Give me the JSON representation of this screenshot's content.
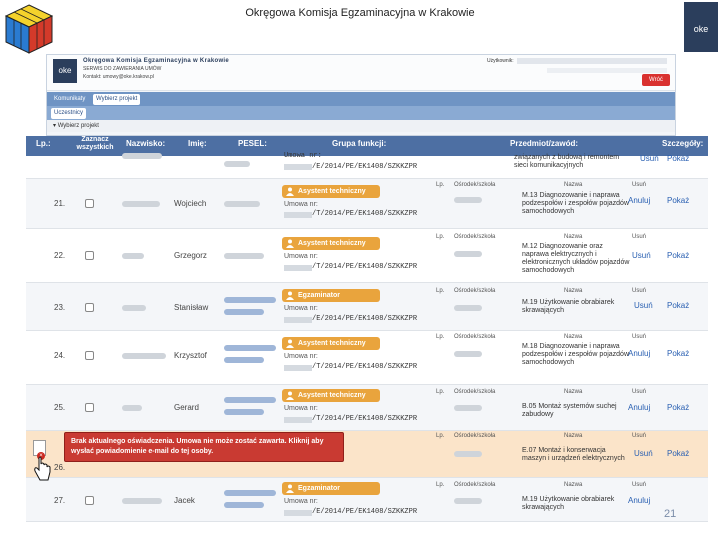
{
  "slide_title": "Okręgowa Komisja Egzaminacyjna w Krakowie",
  "page_number": "21",
  "app": {
    "name": "Okręgowa Komisja Egzaminacyjna w Krakowie",
    "subtitle": "SERWIS DO ZAWIERANIA UMÓW",
    "contact": "Kontakt: umowy@oke.krakow.pl",
    "user_label": "Użytkownik:",
    "back_button": "Wróć",
    "logo_text": "oke"
  },
  "nav": {
    "tabs": [
      {
        "label": "Komunikaty",
        "active": false
      },
      {
        "label": "Wybierz projekt",
        "active": true
      }
    ],
    "sub_tab": "Uczestnicy",
    "select_project": "Wybierz projekt"
  },
  "table": {
    "headers": {
      "lp": "Lp.:",
      "zaznacz": "Zaznacz wszystkich",
      "nazwisko": "Nazwisko:",
      "imie": "Imię:",
      "pesel": "PESEL:",
      "grupa": "Grupa funkcji:",
      "przedmiot": "Przedmiot/zawód:",
      "szczegoly": "Szczegóły:"
    },
    "sub_headers": {
      "lp": "Lp.",
      "osrodek": "Ośrodek/szkoła",
      "nazwa": "Nazwa",
      "usun": "Usuń"
    },
    "umowa_label": "Umowa nr:",
    "rows": [
      {
        "lp": "",
        "imie": "",
        "role": "",
        "umowa": "/E/2014/PE/EK1408/SZKKZPR",
        "przedmiot": "związanych z budową i remontem sieci komunikacyjnych",
        "action": "Usuń",
        "details": "Pokaż"
      },
      {
        "lp": "21.",
        "imie": "Wojciech",
        "role": "Asystent techniczny",
        "umowa": "/T/2014/PE/EK1408/SZKKZPR",
        "przedmiot": "M.13 Diagnozowanie i naprawa podzespołów i zespołów pojazdów samochodowych",
        "action": "Anuluj",
        "details": "Pokaż"
      },
      {
        "lp": "22.",
        "imie": "Grzegorz",
        "role": "Asystent techniczny",
        "umowa": "/T/2014/PE/EK1408/SZKKZPR",
        "przedmiot": "M.12 Diagnozowanie oraz naprawa elektrycznych i elektronicznych układów pojazdów samochodowych",
        "action": "Usuń",
        "details": "Pokaż"
      },
      {
        "lp": "23.",
        "imie": "Stanisław",
        "role": "Egzaminator",
        "umowa": "/E/2014/PE/EK1408/SZKKZPR",
        "przedmiot": "M.19 Użytkowanie obrabiarek skrawających",
        "action": "Usuń",
        "details": "Pokaż"
      },
      {
        "lp": "24.",
        "imie": "Krzysztof",
        "role": "Asystent techniczny",
        "umowa": "/T/2014/PE/EK1408/SZKKZPR",
        "przedmiot": "M.18 Diagnozowanie i naprawa podzespołów i zespołów pojazdów samochodowych",
        "action": "Anuluj",
        "details": "Pokaż"
      },
      {
        "lp": "25.",
        "imie": "Gerard",
        "role": "Asystent techniczny",
        "umowa": "/T/2014/PE/EK1408/SZKKZPR",
        "przedmiot": "B.05 Montaż systemów suchej zabudowy",
        "action": "Anuluj",
        "details": "Pokaż"
      },
      {
        "lp": "26.",
        "imie": "",
        "role": "",
        "umowa": "",
        "przedmiot": "E.07 Montaż i konserwacja maszyn i urządzeń elektrycznych",
        "action": "Usuń",
        "details": "Pokaż"
      },
      {
        "lp": "27.",
        "imie": "Jacek",
        "role": "Egzaminator",
        "umowa": "/E/2014/PE/EK1408/SZKKZPR",
        "przedmiot": "M.19 Użytkowanie obrabiarek skrawających",
        "action": "Anuluj",
        "details": "Pokaż"
      }
    ]
  },
  "error_message": "Brak aktualnego oświadczenia. Umowa nie może zostać zawarta. Kliknij aby wysłać powiadomienie e-mail do tej osoby.",
  "colors": {
    "header_blue": "#4d6fa3",
    "badge_orange": "#e9a43d",
    "error_red": "#c93a32",
    "link_blue": "#2a60b2",
    "alert_row": "#fbe4c9"
  }
}
